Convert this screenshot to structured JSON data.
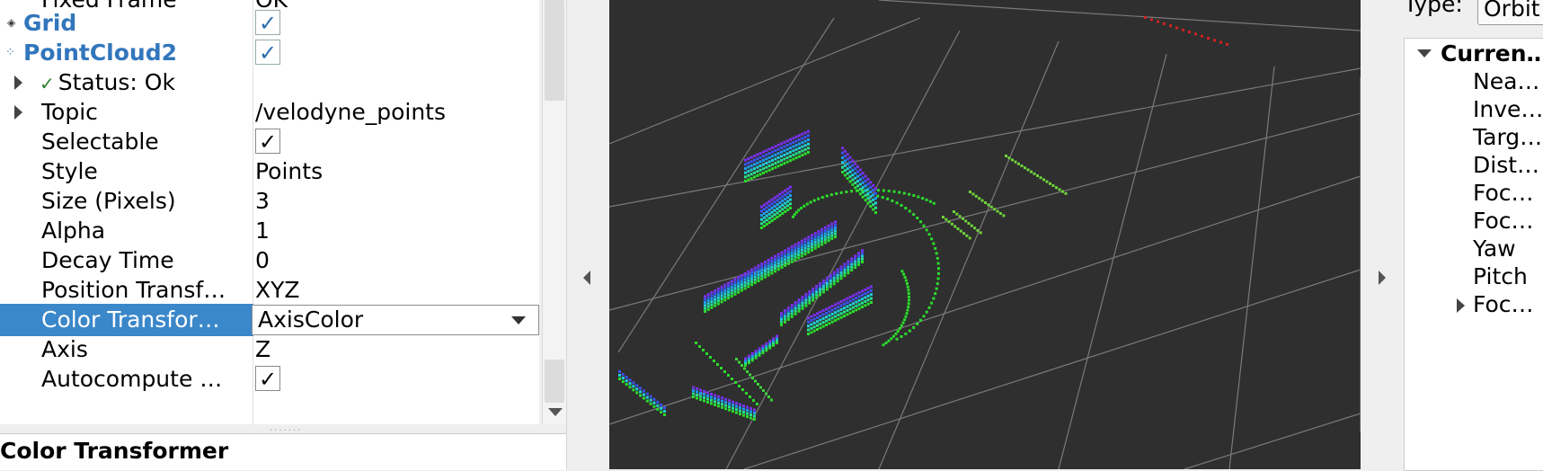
{
  "displays": {
    "rows": [
      {
        "label": "Fixed Frame",
        "value": "OK"
      },
      {
        "label": "Grid",
        "checked": "✓"
      },
      {
        "label": "PointCloud2",
        "checked": "✓"
      },
      {
        "label": "Status: Ok",
        "status_icon": "✓"
      },
      {
        "label": "Topic",
        "value": "/velodyne_points"
      },
      {
        "label": "Selectable",
        "checked": "✓"
      },
      {
        "label": "Style",
        "value": "Points"
      },
      {
        "label": "Size (Pixels)",
        "value": "3"
      },
      {
        "label": "Alpha",
        "value": "1"
      },
      {
        "label": "Decay Time",
        "value": "0"
      },
      {
        "label": "Position Transf…",
        "value": "XYZ"
      },
      {
        "label": "Color Transfor…",
        "value": "AxisColor"
      },
      {
        "label": "Axis",
        "value": "Z"
      },
      {
        "label": "Autocompute …",
        "checked": "✓"
      }
    ],
    "description_title": "Color Transformer"
  },
  "views": {
    "type_label": "Type:",
    "type_value": "Orbit",
    "current_label": "Curren…",
    "items": [
      "Nea…",
      "Inve…",
      "Targ…",
      "Dist…",
      "Foc…",
      "Foc…",
      "Yaw",
      "Pitch",
      "Foc…"
    ]
  },
  "colors": {
    "selection": "#3a87c9",
    "viewport_bg": "#2f2f2f",
    "grid_line": "#7a7a7a",
    "display_name_blue": "#3276bc"
  },
  "icons": {
    "grid": "grid-icon",
    "pointcloud": "pointcloud-icon",
    "expander": "expand-arrow-icon",
    "collapse_left": "chevron-left-icon",
    "collapse_right": "chevron-right-icon"
  }
}
